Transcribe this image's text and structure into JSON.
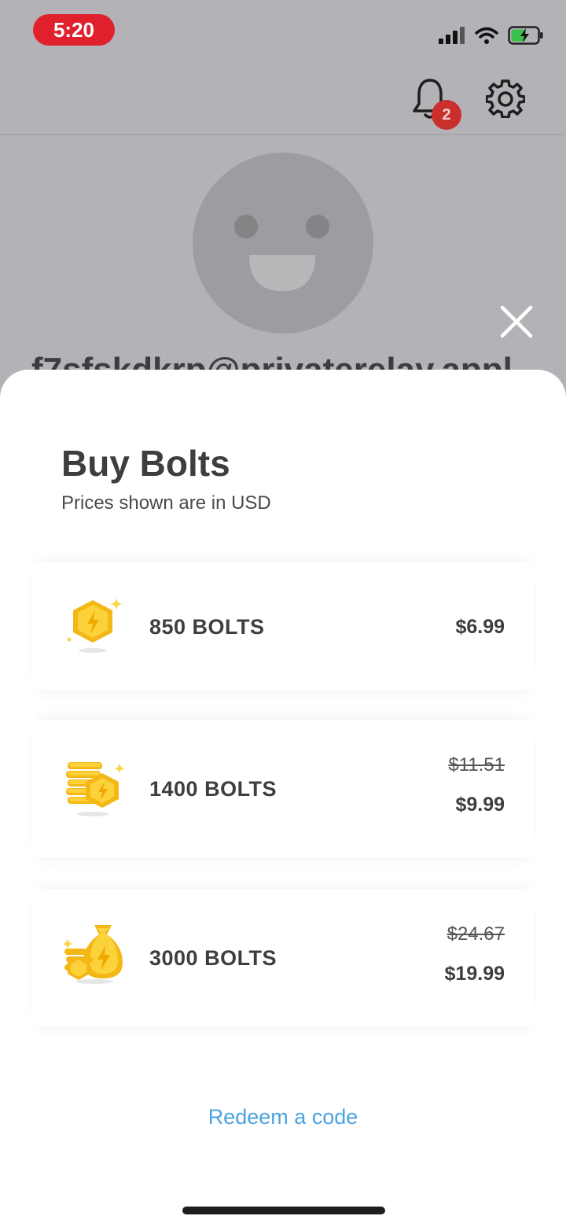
{
  "status_bar": {
    "time": "5:20",
    "icons": [
      "signal-icon",
      "wifi-icon",
      "battery-charging-icon"
    ]
  },
  "header": {
    "notification_count": "2",
    "icons": [
      "bell-icon",
      "gear-icon"
    ]
  },
  "profile": {
    "email_partial": "f7sfskdkrp@privaterelay.appl"
  },
  "sheet": {
    "title": "Buy Bolts",
    "subtitle": "Prices shown are in USD",
    "options": [
      {
        "label": "850 BOLTS",
        "price": "$6.99",
        "old_price": "",
        "icon": "bolt-coin-icon"
      },
      {
        "label": "1400 BOLTS",
        "price": "$9.99",
        "old_price": "$11.51",
        "icon": "bolt-coin-stack-icon"
      },
      {
        "label": "3000 BOLTS",
        "price": "$19.99",
        "old_price": "$24.67",
        "icon": "bolt-money-bag-icon"
      }
    ],
    "redeem_label": "Redeem a code"
  },
  "colors": {
    "time_pill": "#e0202c",
    "badge": "#c9302c",
    "link": "#4aa3e0",
    "coin_gold": "#f6c21c"
  }
}
